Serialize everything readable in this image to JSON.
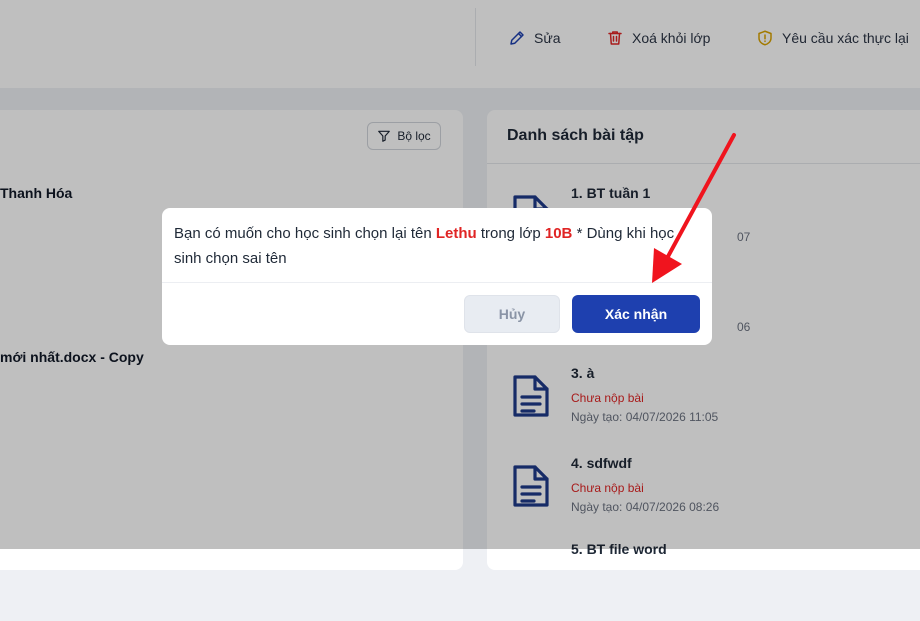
{
  "colors": {
    "accent": "#1e40af",
    "danger": "#e02424",
    "arrow": "#f0141e"
  },
  "toolbar": {
    "edit_label": "Sửa",
    "edit_icon": "pencil-icon",
    "remove_label": "Xoá khỏi lớp",
    "remove_icon": "trash-icon",
    "reverify_label": "Yêu cầu xác thực lại",
    "reverify_icon": "shield-alert-icon"
  },
  "left_panel": {
    "filter_label": "Bộ lọc",
    "filter_icon": "filter-icon",
    "items": [
      "Thanh Hóa",
      "mới nhất.docx - Copy"
    ]
  },
  "assignments": {
    "title": "Danh sách bài tập",
    "items": [
      {
        "name": "1. BT tuần 1",
        "status": "",
        "date": "07"
      },
      {
        "name": "",
        "status": "",
        "date": "06"
      },
      {
        "name": "3. à",
        "status": "Chưa nộp bài",
        "date": "Ngày tạo: 04/07/2026 11:05"
      },
      {
        "name": "4. sdfwdf",
        "status": "Chưa nộp bài",
        "date": "Ngày tạo: 04/07/2026 08:26"
      },
      {
        "name": "5. BT file word",
        "status": "",
        "date": ""
      }
    ]
  },
  "dialog": {
    "text_before": "Bạn có muốn cho học sinh chọn lại tên ",
    "student": "Lethu",
    "text_middle": " trong lớp ",
    "class_name": "10B",
    "text_after": " * Dùng khi học sinh chọn sai tên",
    "cancel_label": "Hủy",
    "confirm_label": "Xác nhận"
  }
}
